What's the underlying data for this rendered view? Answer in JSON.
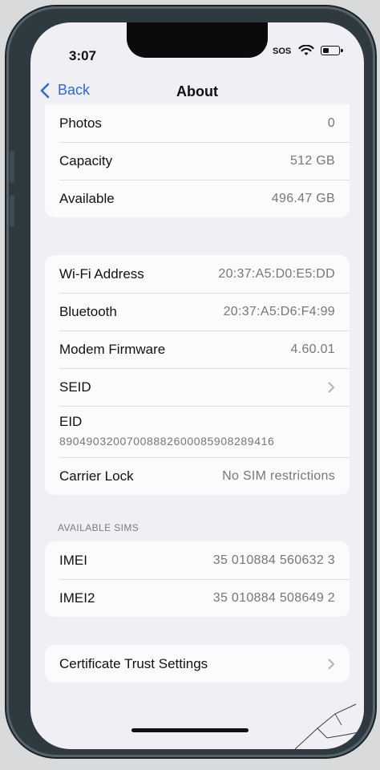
{
  "status_bar": {
    "time": "3:07",
    "carrier": "SOS",
    "wifi_icon": "wifi-icon",
    "battery_icon": "battery-icon"
  },
  "nav": {
    "back_label": "Back",
    "title": "About",
    "back_icon": "chevron-left-icon"
  },
  "storage": [
    {
      "label": "Photos",
      "value": "0"
    },
    {
      "label": "Capacity",
      "value": "512 GB"
    },
    {
      "label": "Available",
      "value": "496.47 GB"
    }
  ],
  "network": {
    "wifi_address": {
      "label": "Wi-Fi Address",
      "value": "20:37:A5:D0:E5:DD"
    },
    "bluetooth": {
      "label": "Bluetooth",
      "value": "20:37:A5:D6:F4:99"
    },
    "modem_firmware": {
      "label": "Modem Firmware",
      "value": "4.60.01"
    },
    "seid": {
      "label": "SEID"
    },
    "eid": {
      "label": "EID",
      "value": "89049032007008882600085908289416"
    },
    "carrier_lock": {
      "label": "Carrier Lock",
      "value": "No SIM restrictions"
    }
  },
  "available_sims": {
    "header": "AVAILABLE SIMS",
    "items": [
      {
        "label": "IMEI",
        "value": "35 010884 560632 3"
      },
      {
        "label": "IMEI2",
        "value": "35 010884 508649 2"
      }
    ]
  },
  "certificate": {
    "label": "Certificate Trust Settings"
  },
  "colors": {
    "accent": "#2e69d6",
    "background": "#f0f0f4",
    "cell": "#fbfbfd",
    "secondary_text": "#777777"
  }
}
